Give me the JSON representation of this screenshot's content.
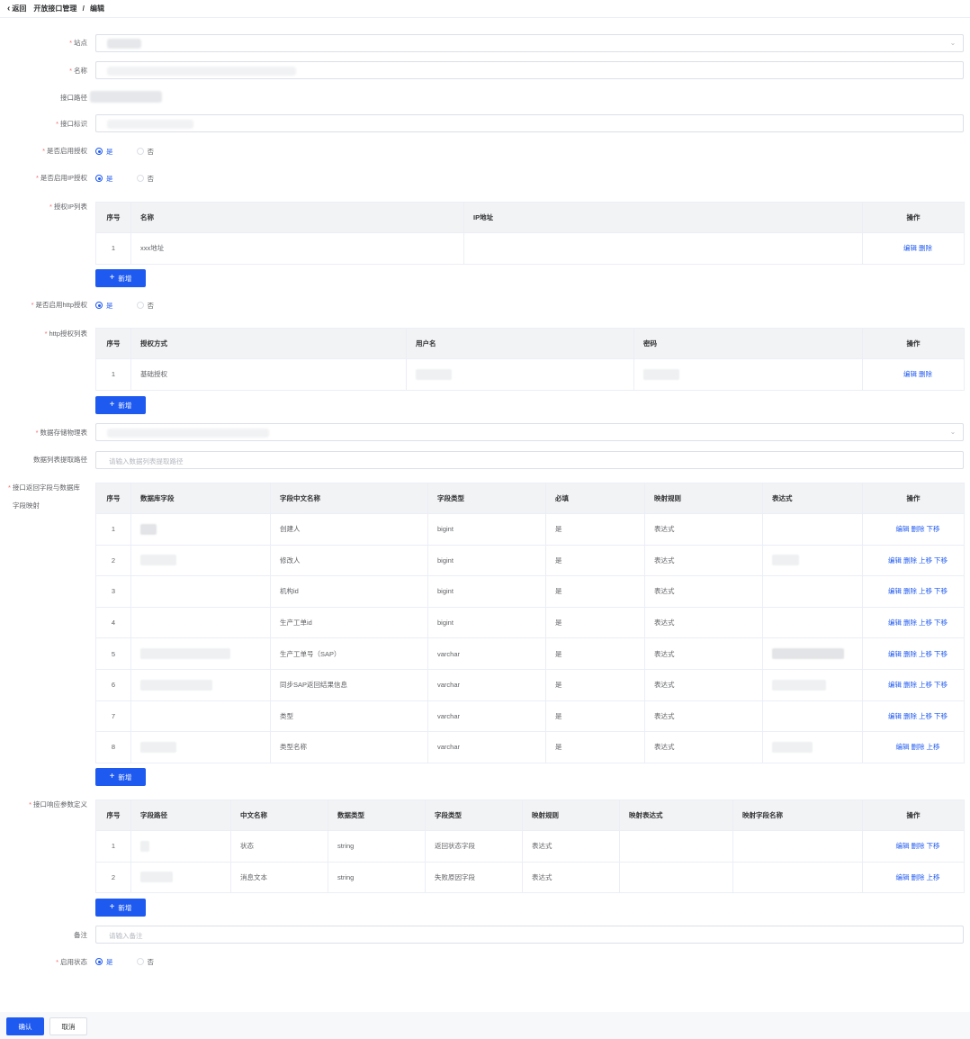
{
  "header": {
    "back": "返回",
    "crumb_parent": "开放接口管理",
    "sep": "/",
    "crumb_current": "编辑"
  },
  "form": {
    "site_label": "站点",
    "name_label": "名称",
    "path_label": "接口路径",
    "ident_label": "接口标识",
    "auth_label": "是否启用授权",
    "ip_auth_label": "是否启用IP授权",
    "ip_list_label": "授权IP列表",
    "http_auth_label": "是否启用http授权",
    "http_list_label": "http授权列表",
    "storage_label": "数据存储物理表",
    "extract_label": "数据列表提取路径",
    "extract_placeholder": "请输入数据列表提取路径",
    "mapping_label_1": "接口返回字段与数据库",
    "mapping_label_2": "字段映射",
    "response_label": "接口响应参数定义",
    "remark_label": "备注",
    "remark_placeholder": "请输入备注",
    "status_label": "启用状态",
    "yes": "是",
    "no": "否"
  },
  "ip_table": {
    "headers": [
      "序号",
      "名称",
      "IP地址",
      "操作"
    ],
    "rows": [
      {
        "no": "1",
        "name": "xxx地址",
        "edit": "编辑",
        "del": "删除"
      }
    ]
  },
  "http_table": {
    "headers": [
      "序号",
      "授权方式",
      "用户名",
      "密码",
      "操作"
    ],
    "rows": [
      {
        "no": "1",
        "method": "基础授权",
        "edit": "编辑",
        "del": "删除"
      }
    ]
  },
  "mapping_table": {
    "headers": [
      "序号",
      "数据库字段",
      "字段中文名称",
      "字段类型",
      "必填",
      "映射规则",
      "表达式",
      "操作"
    ],
    "rows": [
      {
        "no": "1",
        "cn": "创建人",
        "type": "bigint",
        "req": "是",
        "rule": "表达式",
        "ops": [
          "编辑",
          "删除",
          "下移"
        ]
      },
      {
        "no": "2",
        "cn": "修改人",
        "type": "bigint",
        "req": "是",
        "rule": "表达式",
        "ops": [
          "编辑",
          "删除",
          "上移",
          "下移"
        ]
      },
      {
        "no": "3",
        "cn": "机构id",
        "type": "bigint",
        "req": "是",
        "rule": "表达式",
        "ops": [
          "编辑",
          "删除",
          "上移",
          "下移"
        ]
      },
      {
        "no": "4",
        "cn": "生产工单id",
        "type": "bigint",
        "req": "是",
        "rule": "表达式",
        "ops": [
          "编辑",
          "删除",
          "上移",
          "下移"
        ]
      },
      {
        "no": "5",
        "cn": "生产工单号（SAP）",
        "type": "varchar",
        "req": "是",
        "rule": "表达式",
        "ops": [
          "编辑",
          "删除",
          "上移",
          "下移"
        ]
      },
      {
        "no": "6",
        "cn": "同步SAP返回结果信息",
        "type": "varchar",
        "req": "是",
        "rule": "表达式",
        "ops": [
          "编辑",
          "删除",
          "上移",
          "下移"
        ]
      },
      {
        "no": "7",
        "cn": "类型",
        "type": "varchar",
        "req": "是",
        "rule": "表达式",
        "ops": [
          "编辑",
          "删除",
          "上移",
          "下移"
        ]
      },
      {
        "no": "8",
        "cn": "类型名称",
        "type": "varchar",
        "req": "是",
        "rule": "表达式",
        "ops": [
          "编辑",
          "删除",
          "上移"
        ]
      }
    ]
  },
  "response_table": {
    "headers": [
      "序号",
      "字段路径",
      "中文名称",
      "数据类型",
      "字段类型",
      "映射规则",
      "映射表达式",
      "映射字段名称",
      "操作"
    ],
    "rows": [
      {
        "no": "1",
        "cn": "状态",
        "dtype": "string",
        "ftype": "返回状态字段",
        "rule": "表达式",
        "ops": [
          "编辑",
          "删除",
          "下移"
        ]
      },
      {
        "no": "2",
        "cn": "消息文本",
        "dtype": "string",
        "ftype": "失败原因字段",
        "rule": "表达式",
        "ops": [
          "编辑",
          "删除",
          "上移"
        ]
      }
    ]
  },
  "buttons": {
    "add": "新增",
    "plus": "+",
    "confirm": "确认",
    "cancel": "取消"
  },
  "colors": {
    "primary": "#1f5af0",
    "required": "#f56c6c"
  }
}
